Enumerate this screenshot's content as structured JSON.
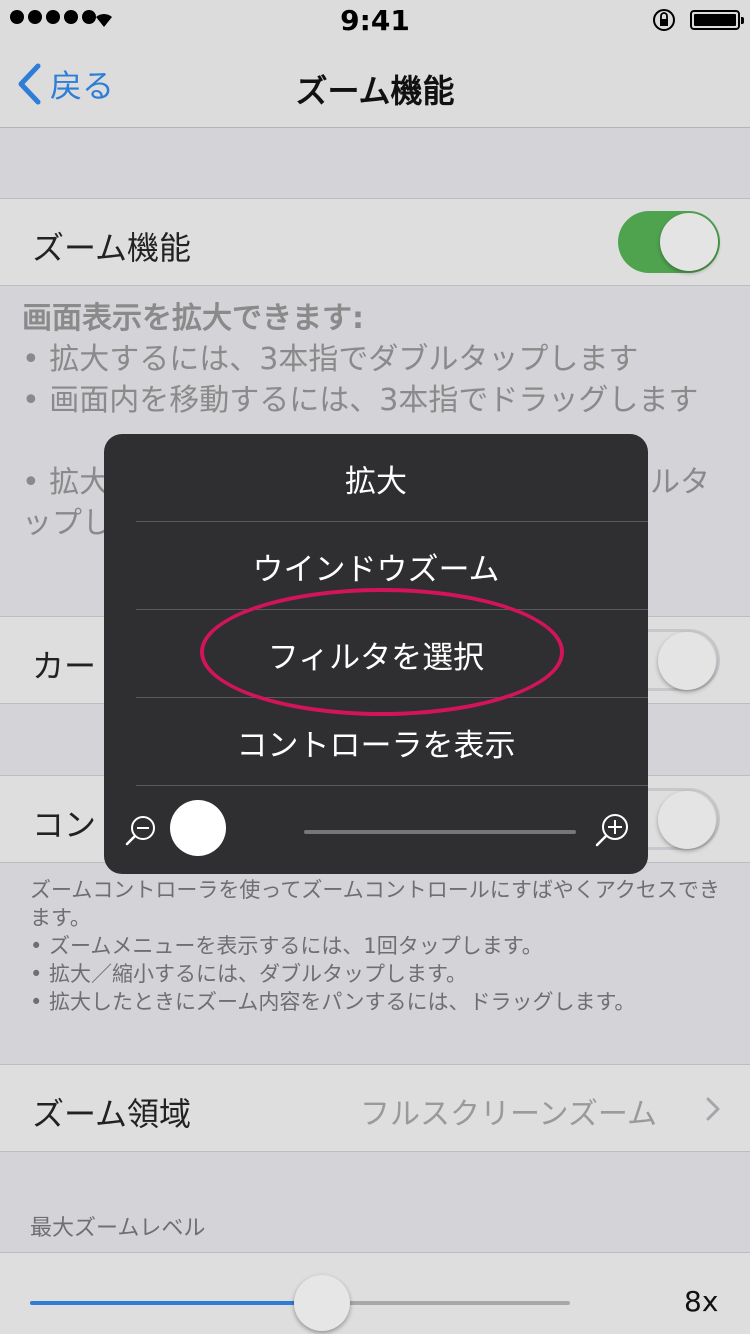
{
  "status_bar": {
    "signal_dots": 5,
    "time": "9:41",
    "icons": [
      "wifi-icon",
      "orientation-lock-icon",
      "battery-icon"
    ]
  },
  "nav": {
    "back_label": "戻る",
    "title": "ズーム機能"
  },
  "zoom_toggle": {
    "label": "ズーム機能",
    "on": true,
    "on_color": "#4fa34f"
  },
  "zoom_description": {
    "heading": "画面表示を拡大できます:",
    "lines": [
      "•  拡大するには、3本指でダブルタップします",
      "•  画面内を移動するには、3本指でドラッグします",
      "•  拡大",
      "ルタ",
      "ップし"
    ]
  },
  "cursor_toggle": {
    "label_partial": "カー"
  },
  "controller_toggle": {
    "label_partial": "コン"
  },
  "controller_description": [
    "ズームコントローラを使ってズームコントロールにすばやくアクセスできます。",
    "• ズームメニューを表示するには、1回タップします。",
    "• 拡大／縮小するには、ダブルタップします。",
    "• 拡大したときにズーム内容をパンするには、ドラッグします。"
  ],
  "zoom_region": {
    "label": "ズーム領域",
    "value": "フルスクリーンズーム"
  },
  "max_zoom": {
    "header": "最大ズームレベル",
    "value_label": "8x",
    "level_fraction": 0.54,
    "accent_color": "#2e7dd6"
  },
  "zoom_menu": {
    "items": [
      "拡大",
      "ウインドウズーム",
      "フィルタを選択",
      "コントローラを表示"
    ],
    "highlighted_index": 2,
    "highlight_color": "#d4145a",
    "zoom_slider_fraction": 0.0
  }
}
